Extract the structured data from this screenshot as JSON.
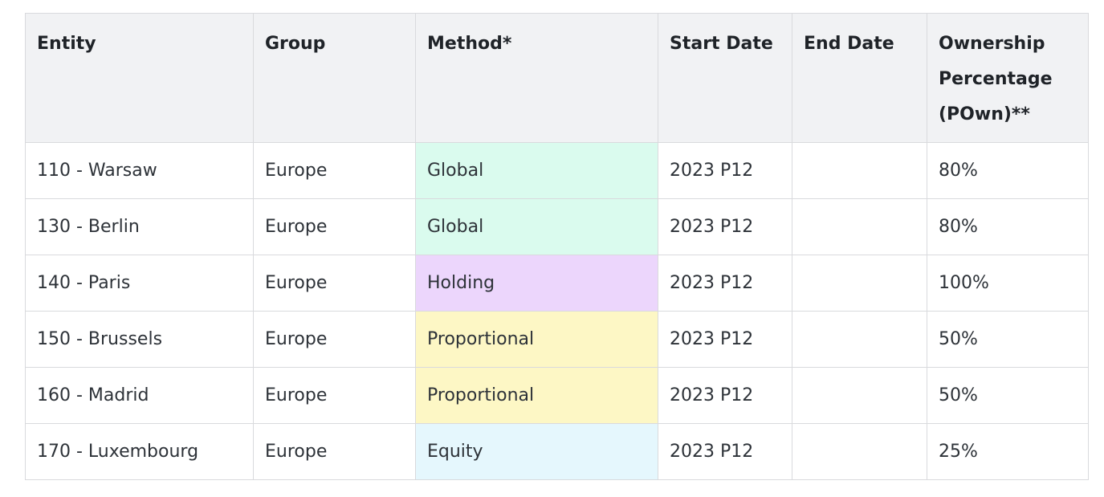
{
  "table": {
    "headers": [
      "Entity",
      "Group",
      "Method*",
      "Start Date",
      "End Date",
      "Ownership Percentage (POwn)**"
    ],
    "rows": [
      {
        "entity": "110 - Warsaw",
        "group": "Europe",
        "method": "Global",
        "start": "2023 P12",
        "end": "",
        "pown": "80%"
      },
      {
        "entity": "130 - Berlin",
        "group": "Europe",
        "method": "Global",
        "start": "2023 P12",
        "end": "",
        "pown": "80%"
      },
      {
        "entity": "140 - Paris",
        "group": "Europe",
        "method": "Holding",
        "start": "2023 P12",
        "end": "",
        "pown": "100%"
      },
      {
        "entity": "150 - Brussels",
        "group": "Europe",
        "method": "Proportional",
        "start": "2023 P12",
        "end": "",
        "pown": "50%"
      },
      {
        "entity": "160 - Madrid",
        "group": "Europe",
        "method": "Proportional",
        "start": "2023 P12",
        "end": "",
        "pown": "50%"
      },
      {
        "entity": "170 - Luxembourg",
        "group": "Europe",
        "method": "Equity",
        "start": "2023 P12",
        "end": "",
        "pown": "25%"
      }
    ]
  },
  "colors": {
    "header_bg": "#f1f2f4",
    "border": "#d9dadd",
    "global": "#dafbee",
    "holding": "#ecd6fc",
    "proportional": "#fdf7c5",
    "equity": "#e5f7fd"
  }
}
